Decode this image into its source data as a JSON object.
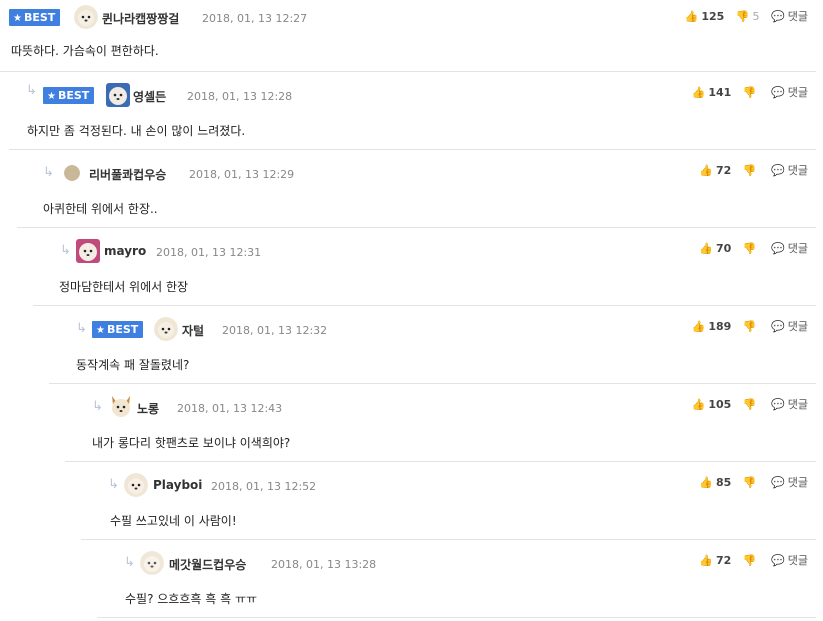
{
  "best_label": "BEST",
  "reply_label": "댓글",
  "comments": [
    {
      "nick": "퀸나라캡짱짱걸",
      "date": "2018, 01, 13 12:27",
      "body": "따뜻하다. 가슴속이 편한하다.",
      "up": "125",
      "down": "5"
    },
    {
      "nick": "영셀든",
      "date": "2018, 01, 13 12:28",
      "body": "하지만 좀 걱정된다. 내 손이 많이 느려졌다.",
      "up": "141",
      "down": ""
    },
    {
      "nick": "리버풀콰컵우승",
      "date": "2018, 01, 13 12:29",
      "body": "아퀴한테 위에서 한장..",
      "up": "72",
      "down": ""
    },
    {
      "nick": "mayro",
      "date": "2018, 01, 13 12:31",
      "body": "정마담한테서 위에서 한장",
      "up": "70",
      "down": ""
    },
    {
      "nick": "자털",
      "date": "2018, 01, 13 12:32",
      "body": "동작계속 패 잘돌렸네?",
      "up": "189",
      "down": ""
    },
    {
      "nick": "노롱",
      "date": "2018, 01, 13 12:43",
      "body": "내가 롱다리 핫팬츠로 보이냐 이색희야?",
      "up": "105",
      "down": ""
    },
    {
      "nick": "Playboi",
      "date": "2018, 01, 13 12:52",
      "body": "수필 쓰고있네 이 사람이!",
      "up": "85",
      "down": ""
    },
    {
      "nick": "메갓월드컵우승",
      "date": "2018, 01, 13 13:28",
      "body": "수필? 으흐흐흑 흑 흑 ㅠㅠ",
      "up": "72",
      "down": ""
    }
  ]
}
